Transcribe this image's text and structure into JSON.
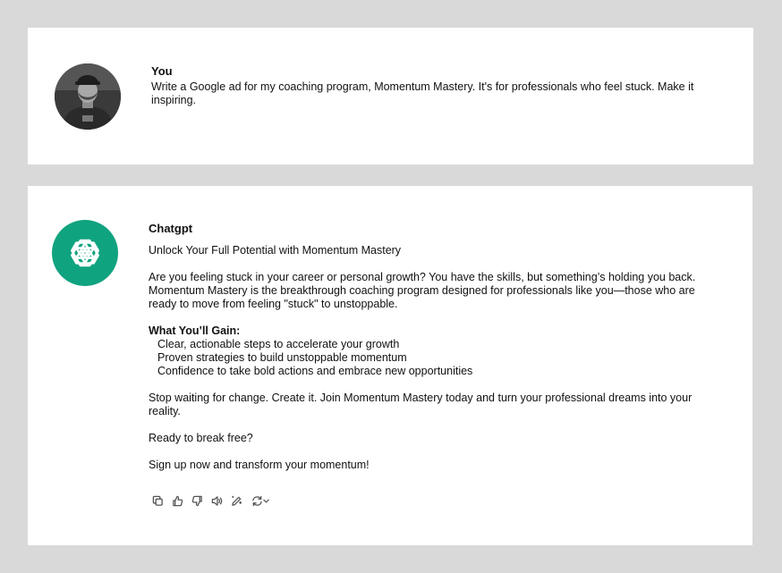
{
  "user_message": {
    "author": "You",
    "text": "Write a Google ad for my coaching program, Momentum Mastery. It's for professionals who feel stuck. Make it inspiring."
  },
  "assistant_message": {
    "author": "Chatgpt",
    "headline": "Unlock Your Full Potential with Momentum Mastery",
    "intro": "Are you feeling stuck in your career or personal growth? You have the skills, but something’s holding you back. Momentum Mastery is the breakthrough coaching program designed for professionals like you—those who are ready to move from feeling \"stuck\" to unstoppable.",
    "gain_heading": "What You’ll Gain:",
    "gains": [
      "Clear, actionable steps to accelerate your growth",
      "Proven strategies to build unstoppable momentum",
      "Confidence to take bold actions and embrace new opportunities"
    ],
    "cta_1": "Stop waiting for change. Create it. Join Momentum Mastery today and turn your professional dreams into your reality.",
    "cta_2": "Ready to break free?",
    "cta_3": "Sign up now and transform your momentum!"
  },
  "actions": [
    {
      "icon": "copy-icon"
    },
    {
      "icon": "thumbs-up-icon"
    },
    {
      "icon": "thumbs-down-icon"
    },
    {
      "icon": "read-aloud-icon"
    },
    {
      "icon": "edit-icon"
    },
    {
      "icon": "regenerate-icon"
    }
  ],
  "colors": {
    "background": "#d9d9d9",
    "card": "#ffffff",
    "chatgpt_brand": "#10a37f",
    "icon": "#555555"
  }
}
